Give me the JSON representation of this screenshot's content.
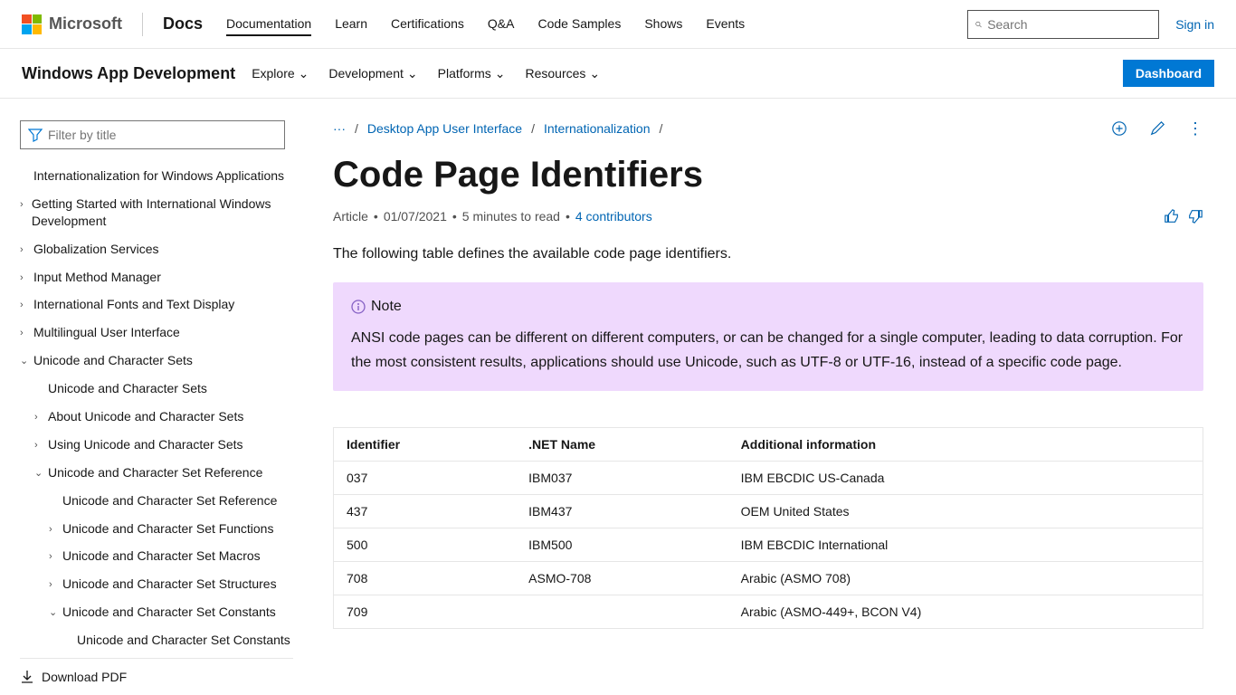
{
  "header": {
    "brand": "Microsoft",
    "docs": "Docs",
    "nav": [
      "Documentation",
      "Learn",
      "Certifications",
      "Q&A",
      "Code Samples",
      "Shows",
      "Events"
    ],
    "search_placeholder": "Search",
    "signin": "Sign in"
  },
  "subheader": {
    "title": "Windows App Development",
    "nav": [
      "Explore",
      "Development",
      "Platforms",
      "Resources"
    ],
    "dashboard": "Dashboard"
  },
  "sidebar": {
    "filter_placeholder": "Filter by title",
    "items": [
      {
        "label": "Internationalization for Windows Applications",
        "indent": 0,
        "arrow": ""
      },
      {
        "label": "Getting Started with International Windows Development",
        "indent": 0,
        "arrow": "›"
      },
      {
        "label": "Globalization Services",
        "indent": 0,
        "arrow": "›"
      },
      {
        "label": "Input Method Manager",
        "indent": 0,
        "arrow": "›"
      },
      {
        "label": "International Fonts and Text Display",
        "indent": 0,
        "arrow": "›"
      },
      {
        "label": "Multilingual User Interface",
        "indent": 0,
        "arrow": "›"
      },
      {
        "label": "Unicode and Character Sets",
        "indent": 0,
        "arrow": "⌄"
      },
      {
        "label": "Unicode and Character Sets",
        "indent": 1,
        "arrow": ""
      },
      {
        "label": "About Unicode and Character Sets",
        "indent": 1,
        "arrow": "›"
      },
      {
        "label": "Using Unicode and Character Sets",
        "indent": 1,
        "arrow": "›"
      },
      {
        "label": "Unicode and Character Set Reference",
        "indent": 1,
        "arrow": "⌄"
      },
      {
        "label": "Unicode and Character Set Reference",
        "indent": 2,
        "arrow": ""
      },
      {
        "label": "Unicode and Character Set Functions",
        "indent": 2,
        "arrow": "›"
      },
      {
        "label": "Unicode and Character Set Macros",
        "indent": 2,
        "arrow": "›"
      },
      {
        "label": "Unicode and Character Set Structures",
        "indent": 2,
        "arrow": "›"
      },
      {
        "label": "Unicode and Character Set Constants",
        "indent": 2,
        "arrow": "⌄"
      },
      {
        "label": "Unicode and Character Set Constants",
        "indent": 3,
        "arrow": ""
      }
    ],
    "download": "Download PDF"
  },
  "breadcrumb": {
    "more": "···",
    "items": [
      "Desktop App User Interface",
      "Internationalization"
    ]
  },
  "article": {
    "title": "Code Page Identifiers",
    "meta_type": "Article",
    "meta_date": "01/07/2021",
    "meta_read": "5 minutes to read",
    "meta_contrib": "4 contributors",
    "intro": "The following table defines the available code page identifiers.",
    "note_label": "Note",
    "note_body": "ANSI code pages can be different on different computers, or can be changed for a single computer, leading to data corruption. For the most consistent results, applications should use Unicode, such as UTF-8 or UTF-16, instead of a specific code page."
  },
  "table": {
    "headers": [
      "Identifier",
      ".NET Name",
      "Additional information"
    ],
    "rows": [
      [
        "037",
        "IBM037",
        "IBM EBCDIC US-Canada"
      ],
      [
        "437",
        "IBM437",
        "OEM United States"
      ],
      [
        "500",
        "IBM500",
        "IBM EBCDIC International"
      ],
      [
        "708",
        "ASMO-708",
        "Arabic (ASMO 708)"
      ],
      [
        "709",
        "",
        "Arabic (ASMO-449+, BCON V4)"
      ]
    ]
  }
}
